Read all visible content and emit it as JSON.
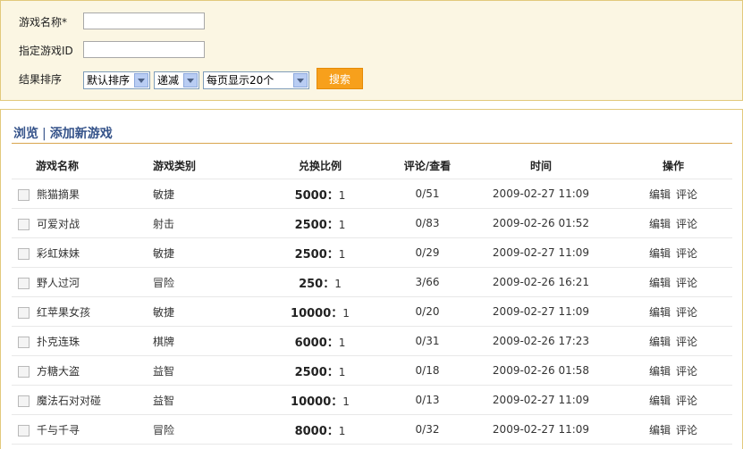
{
  "search": {
    "name_label": "游戏名称*",
    "id_label": "指定游戏ID",
    "sort_label": "结果排序",
    "sort_by": "默认排序",
    "order": "递减",
    "per_page": "每页显示20个",
    "button": "搜索"
  },
  "list": {
    "browse": "浏览",
    "separator": "|",
    "add": "添加新游戏",
    "headers": [
      "游戏名称",
      "游戏类别",
      "兑换比例",
      "评论/查看",
      "时间",
      "操作"
    ],
    "edit_label": "编辑",
    "comment_label": "评论",
    "rows": [
      {
        "name": "熊猫摘果",
        "type": "敏捷",
        "ratio": "5000",
        "ratio_sep": "：",
        "ratio_to": "1",
        "views": "0/51",
        "time": "2009-02-27 11:09"
      },
      {
        "name": "可爱对战",
        "type": "射击",
        "ratio": "2500",
        "ratio_sep": "：",
        "ratio_to": "1",
        "views": "0/83",
        "time": "2009-02-26 01:52"
      },
      {
        "name": "彩虹妹妹",
        "type": "敏捷",
        "ratio": "2500",
        "ratio_sep": "：",
        "ratio_to": "1",
        "views": "0/29",
        "time": "2009-02-27 11:09"
      },
      {
        "name": "野人过河",
        "type": "冒险",
        "ratio": "250",
        "ratio_sep": "：",
        "ratio_to": "1",
        "views": "3/66",
        "time": "2009-02-26 16:21"
      },
      {
        "name": "红苹果女孩",
        "type": "敏捷",
        "ratio": "10000",
        "ratio_sep": "：",
        "ratio_to": "1",
        "views": "0/20",
        "time": "2009-02-27 11:09"
      },
      {
        "name": "扑克连珠",
        "type": "棋牌",
        "ratio": "6000",
        "ratio_sep": "：",
        "ratio_to": "1",
        "views": "0/31",
        "time": "2009-02-26 17:23"
      },
      {
        "name": "方糖大盗",
        "type": "益智",
        "ratio": "2500",
        "ratio_sep": "：",
        "ratio_to": "1",
        "views": "0/18",
        "time": "2009-02-26 01:58"
      },
      {
        "name": "魔法石对对碰",
        "type": "益智",
        "ratio": "10000",
        "ratio_sep": "：",
        "ratio_to": "1",
        "views": "0/13",
        "time": "2009-02-27 11:09"
      },
      {
        "name": "千与千寻",
        "type": "冒险",
        "ratio": "8000",
        "ratio_sep": "：",
        "ratio_to": "1",
        "views": "0/32",
        "time": "2009-02-27 11:09"
      }
    ]
  }
}
